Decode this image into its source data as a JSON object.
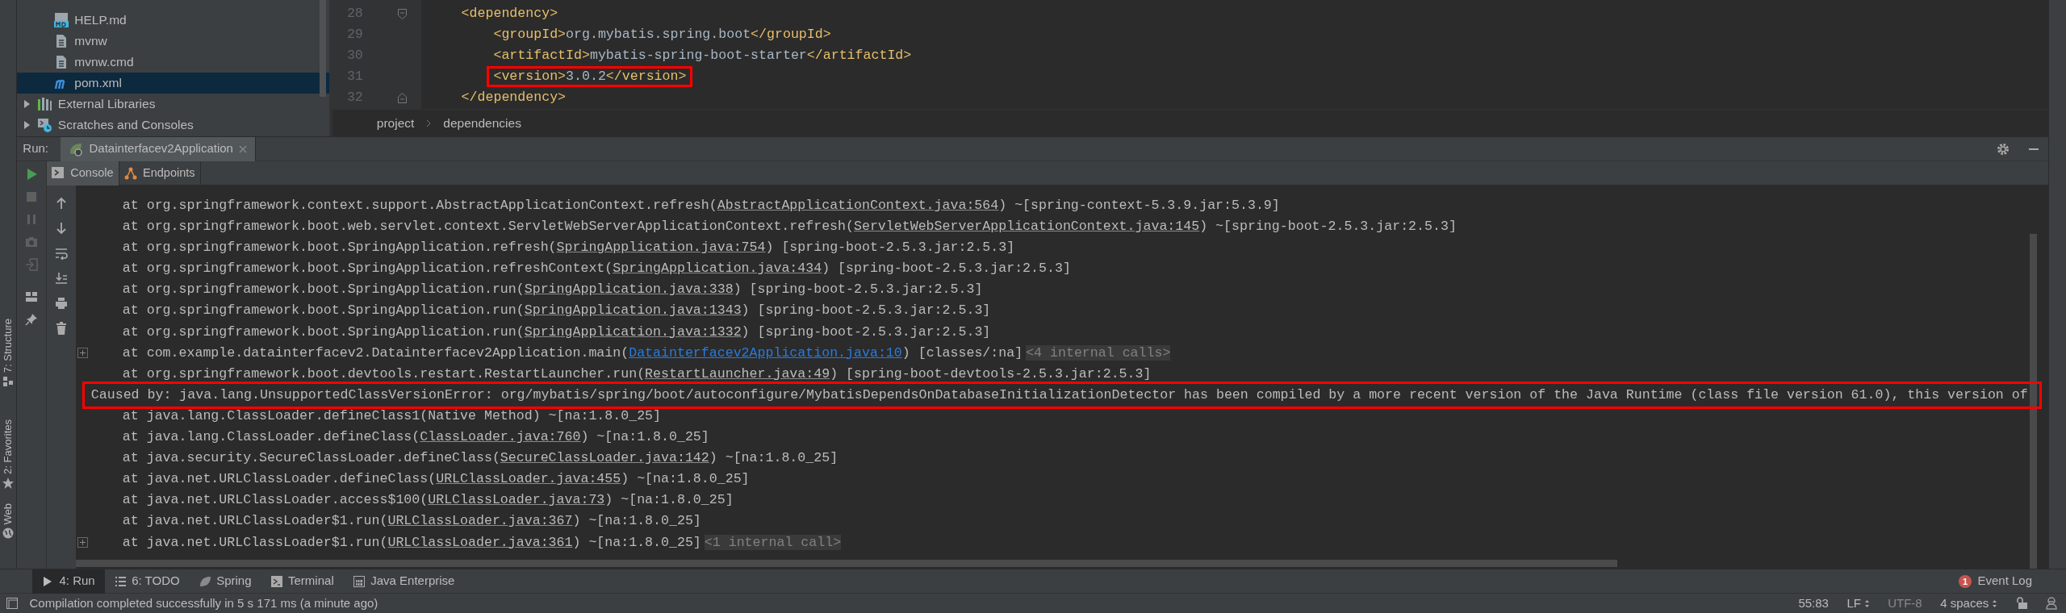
{
  "project_tree": {
    "items": [
      {
        "label": "HELP.md",
        "kind": "markdown",
        "selected": false
      },
      {
        "label": "mvnw",
        "kind": "text",
        "selected": false
      },
      {
        "label": "mvnw.cmd",
        "kind": "text",
        "selected": false
      },
      {
        "label": "pom.xml",
        "kind": "maven",
        "selected": true
      },
      {
        "label": "External Libraries",
        "kind": "libraries",
        "selected": false,
        "expanded": false
      },
      {
        "label": "Scratches and Consoles",
        "kind": "scratches",
        "selected": false,
        "expanded": false
      }
    ]
  },
  "editor": {
    "lines": [
      {
        "number": "28",
        "kind": "fold_start",
        "segments": [
          {
            "kind": "tag",
            "text": "<dependency>"
          }
        ],
        "children": [
          {
            "number": "29",
            "segments": [
              {
                "kind": "tag",
                "text": "<groupId>"
              },
              {
                "kind": "text",
                "text": "org.mybatis.spring.boot"
              },
              {
                "kind": "tag",
                "text": "</groupId>"
              }
            ]
          },
          {
            "number": "30",
            "segments": [
              {
                "kind": "tag",
                "text": "<artifactId>"
              },
              {
                "kind": "text",
                "text": "mybatis-spring-boot-starter"
              },
              {
                "kind": "tag",
                "text": "</artifactId>"
              }
            ]
          },
          {
            "number": "31",
            "highlighted": true,
            "segments": [
              {
                "kind": "tag",
                "text": "<version>"
              },
              {
                "kind": "text",
                "text": "3.0.2"
              },
              {
                "kind": "tag",
                "text": "</version>"
              }
            ]
          }
        ]
      },
      {
        "number": "32",
        "kind": "fold_end",
        "segments": [
          {
            "kind": "tag",
            "text": "</dependency>"
          }
        ]
      }
    ],
    "breadcrumb": [
      "project",
      "dependencies"
    ]
  },
  "run_panel": {
    "label": "Run:",
    "tabs": [
      {
        "title": "Datainterfacev2Application",
        "selected": true
      }
    ],
    "subtabs": [
      {
        "label": "Console",
        "kind": "console",
        "selected": true
      },
      {
        "label": "Endpoints",
        "kind": "endpoints",
        "selected": false
      }
    ],
    "console": {
      "lines": [
        {
          "kind": "frame",
          "segments": [
            {
              "kind": "plain",
              "text": "at org.springframework.context.support.AbstractApplicationContext.refresh("
            },
            {
              "kind": "link",
              "text": "AbstractApplicationContext.java:564"
            },
            {
              "kind": "plain",
              "text": ") ~[spring-context-5.3.9.jar:5.3.9]"
            }
          ]
        },
        {
          "kind": "frame",
          "segments": [
            {
              "kind": "plain",
              "text": "at org.springframework.boot.web.servlet.context.ServletWebServerApplicationContext.refresh("
            },
            {
              "kind": "link",
              "text": "ServletWebServerApplicationContext.java:145"
            },
            {
              "kind": "plain",
              "text": ") ~[spring-boot-2.5.3.jar:2.5.3]"
            }
          ]
        },
        {
          "kind": "frame",
          "segments": [
            {
              "kind": "plain",
              "text": "at org.springframework.boot.SpringApplication.refresh("
            },
            {
              "kind": "link",
              "text": "SpringApplication.java:754"
            },
            {
              "kind": "plain",
              "text": ") [spring-boot-2.5.3.jar:2.5.3]"
            }
          ]
        },
        {
          "kind": "frame",
          "segments": [
            {
              "kind": "plain",
              "text": "at org.springframework.boot.SpringApplication.refreshContext("
            },
            {
              "kind": "link",
              "text": "SpringApplication.java:434"
            },
            {
              "kind": "plain",
              "text": ") [spring-boot-2.5.3.jar:2.5.3]"
            }
          ]
        },
        {
          "kind": "frame",
          "segments": [
            {
              "kind": "plain",
              "text": "at org.springframework.boot.SpringApplication.run("
            },
            {
              "kind": "link",
              "text": "SpringApplication.java:338"
            },
            {
              "kind": "plain",
              "text": ") [spring-boot-2.5.3.jar:2.5.3]"
            }
          ]
        },
        {
          "kind": "frame",
          "segments": [
            {
              "kind": "plain",
              "text": "at org.springframework.boot.SpringApplication.run("
            },
            {
              "kind": "link",
              "text": "SpringApplication.java:1343"
            },
            {
              "kind": "plain",
              "text": ") [spring-boot-2.5.3.jar:2.5.3]"
            }
          ]
        },
        {
          "kind": "frame",
          "segments": [
            {
              "kind": "plain",
              "text": "at org.springframework.boot.SpringApplication.run("
            },
            {
              "kind": "link",
              "text": "SpringApplication.java:1332"
            },
            {
              "kind": "plain",
              "text": ") [spring-boot-2.5.3.jar:2.5.3]"
            }
          ]
        },
        {
          "kind": "frame",
          "foldable": true,
          "segments": [
            {
              "kind": "plain",
              "text": "at com.example.datainterfacev2.Datainterfacev2Application.main("
            },
            {
              "kind": "project_link",
              "text": "Datainterfacev2Application.java:10"
            },
            {
              "kind": "plain",
              "text": ") [classes/:na]"
            },
            {
              "kind": "folded",
              "text": "<4 internal calls>"
            }
          ]
        },
        {
          "kind": "frame",
          "segments": [
            {
              "kind": "plain",
              "text": "at org.springframework.boot.devtools.restart.RestartLauncher.run("
            },
            {
              "kind": "link",
              "text": "RestartLauncher.java:49"
            },
            {
              "kind": "plain",
              "text": ") [spring-boot-devtools-2.5.3.jar:2.5.3]"
            }
          ]
        },
        {
          "kind": "cause",
          "highlighted": true,
          "segments": [
            {
              "kind": "plain",
              "text": "Caused by: java.lang.UnsupportedClassVersionError: org/mybatis/spring/boot/autoconfigure/MybatisDependsOnDatabaseInitializationDetector has been compiled by a more recent version of the Java Runtime (class file version 61.0), this version of"
            }
          ]
        },
        {
          "kind": "frame",
          "segments": [
            {
              "kind": "plain",
              "text": "at java.lang.ClassLoader.defineClass1(Native Method) ~[na:1.8.0_25]"
            }
          ]
        },
        {
          "kind": "frame",
          "segments": [
            {
              "kind": "plain",
              "text": "at java.lang.ClassLoader.defineClass("
            },
            {
              "kind": "link",
              "text": "ClassLoader.java:760"
            },
            {
              "kind": "plain",
              "text": ") ~[na:1.8.0_25]"
            }
          ]
        },
        {
          "kind": "frame",
          "segments": [
            {
              "kind": "plain",
              "text": "at java.security.SecureClassLoader.defineClass("
            },
            {
              "kind": "link",
              "text": "SecureClassLoader.java:142"
            },
            {
              "kind": "plain",
              "text": ") ~[na:1.8.0_25]"
            }
          ]
        },
        {
          "kind": "frame",
          "segments": [
            {
              "kind": "plain",
              "text": "at java.net.URLClassLoader.defineClass("
            },
            {
              "kind": "link",
              "text": "URLClassLoader.java:455"
            },
            {
              "kind": "plain",
              "text": ") ~[na:1.8.0_25]"
            }
          ]
        },
        {
          "kind": "frame",
          "segments": [
            {
              "kind": "plain",
              "text": "at java.net.URLClassLoader.access$100("
            },
            {
              "kind": "link",
              "text": "URLClassLoader.java:73"
            },
            {
              "kind": "plain",
              "text": ") ~[na:1.8.0_25]"
            }
          ]
        },
        {
          "kind": "frame",
          "segments": [
            {
              "kind": "plain",
              "text": "at java.net.URLClassLoader$1.run("
            },
            {
              "kind": "link",
              "text": "URLClassLoader.java:367"
            },
            {
              "kind": "plain",
              "text": ") ~[na:1.8.0_25]"
            }
          ]
        },
        {
          "kind": "frame",
          "foldable": true,
          "segments": [
            {
              "kind": "plain",
              "text": "at java.net.URLClassLoader$1.run("
            },
            {
              "kind": "link",
              "text": "URLClassLoader.java:361"
            },
            {
              "kind": "plain",
              "text": ") ~[na:1.8.0_25]"
            },
            {
              "kind": "folded",
              "text": "<1 internal call>"
            }
          ]
        }
      ]
    }
  },
  "left_stripe": [
    {
      "label": "7: Structure",
      "kind": "structure"
    },
    {
      "label": "2: Favorites",
      "kind": "favorites"
    },
    {
      "label": "Web",
      "kind": "web"
    }
  ],
  "bottom_tabs": [
    {
      "label": "4: Run",
      "kind": "run",
      "selected": true
    },
    {
      "label": "6: TODO",
      "kind": "todo",
      "selected": false
    },
    {
      "label": "Spring",
      "kind": "spring",
      "selected": false
    },
    {
      "label": "Terminal",
      "kind": "terminal",
      "selected": false
    },
    {
      "label": "Java Enterprise",
      "kind": "javaee",
      "selected": false
    }
  ],
  "event_log": {
    "label": "Event Log",
    "count": "1"
  },
  "status_bar": {
    "message": "Compilation completed successfully in 5 s 171 ms (a minute ago)",
    "position": "55:83",
    "line_separator": "LF",
    "encoding": "UTF-8",
    "indent": "4 spaces"
  }
}
